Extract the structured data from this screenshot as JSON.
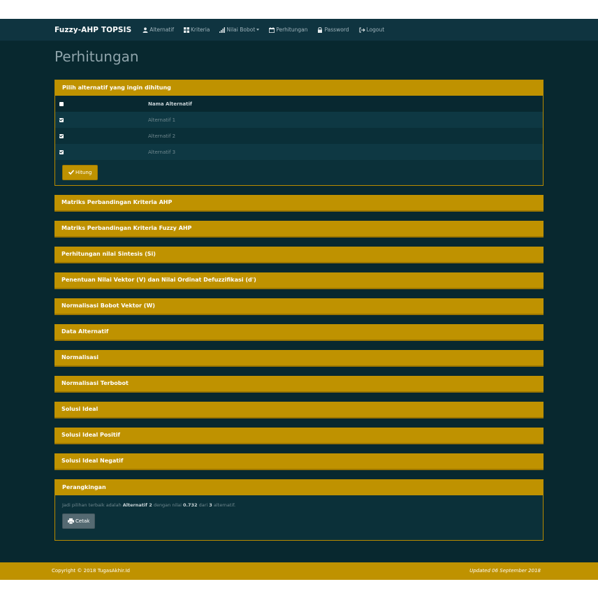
{
  "navbar": {
    "brand": "Fuzzy-AHP TOPSIS",
    "items": [
      {
        "label": "Alternatif",
        "icon": "user-icon"
      },
      {
        "label": "Kriteria",
        "icon": "grid-icon"
      },
      {
        "label": "Nilai Bobot",
        "icon": "signal-icon",
        "dropdown": true
      },
      {
        "label": "Perhitungan",
        "icon": "calendar-icon"
      },
      {
        "label": "Password",
        "icon": "lock-icon"
      },
      {
        "label": "Logout",
        "icon": "logout-icon"
      }
    ]
  },
  "page": {
    "title": "Perhitungan"
  },
  "select_panel": {
    "heading": "Pilih alternatif yang ingin dihitung",
    "column_header": "Nama Alternatif",
    "rows": [
      {
        "name": "Alternatif 1",
        "checked": true
      },
      {
        "name": "Alternatif 2",
        "checked": true
      },
      {
        "name": "Alternatif 3",
        "checked": true
      }
    ],
    "button_label": "Hitung"
  },
  "sections": [
    "Matriks Perbandingan Kriteria AHP",
    "Matriks Perbandingan Kriteria Fuzzy AHP",
    "Perhitungan nilai Sintesis (Si)",
    "Penentuan Nilai Vektor (V) dan Nilai Ordinat Defuzzifikasi (d')",
    "Normalisasi Bobot Vektor (W)",
    "Data Alternatif",
    "Normalisasi",
    "Normalisasi Terbobot",
    "Solusi Ideal",
    "Solusi Ideal Positif",
    "Solusi Ideal Negatif"
  ],
  "ranking": {
    "heading": "Perangkingan",
    "text_before": "Jadi pilihan terbaik adalah",
    "best": "Alternatif 2",
    "text_mid": "dengan nilai",
    "value": "0.732",
    "text_from": "dari",
    "count": "3",
    "text_after": "alternatif.",
    "print_label": "Cetak"
  },
  "footer": {
    "copyright": "Copyright © 2018 TugasAkhir.Id",
    "updated": "Updated 06 September 2018"
  },
  "colors": {
    "accent": "#bf9200",
    "background": "#08282f",
    "navbar": "#0f3440"
  }
}
